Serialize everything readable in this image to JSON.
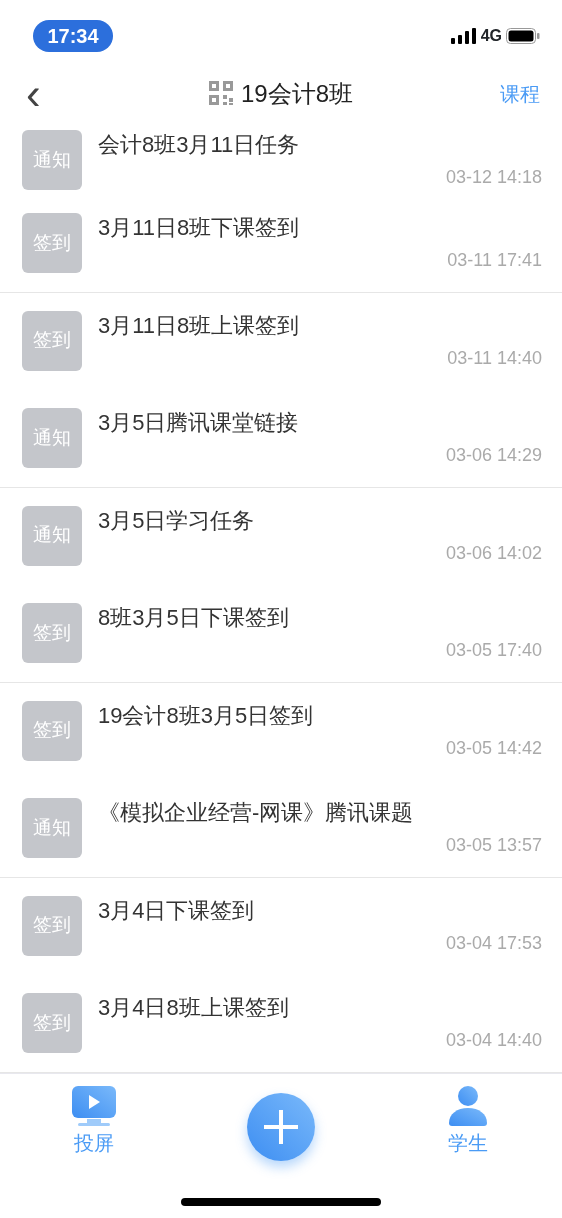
{
  "status_bar": {
    "time": "17:34",
    "network": "4G"
  },
  "nav": {
    "back": "‹",
    "title": "19会计8班",
    "action": "课程"
  },
  "items": [
    {
      "tag": "通知",
      "title": "会计8班3月11日任务",
      "time": "03-12 14:18"
    },
    {
      "tag": "签到",
      "title": "3月11日8班下课签到",
      "time": "03-11 17:41"
    },
    {
      "tag": "签到",
      "title": "3月11日8班上课签到",
      "time": "03-11 14:40"
    },
    {
      "tag": "通知",
      "title": "3月5日腾讯课堂链接",
      "time": "03-06 14:29"
    },
    {
      "tag": "通知",
      "title": "3月5日学习任务",
      "time": "03-06 14:02"
    },
    {
      "tag": "签到",
      "title": "8班3月5日下课签到",
      "time": "03-05 17:40"
    },
    {
      "tag": "签到",
      "title": "19会计8班3月5日签到",
      "time": "03-05 14:42"
    },
    {
      "tag": "通知",
      "title": "《模拟企业经营-网课》腾讯课题",
      "time": "03-05 13:57"
    },
    {
      "tag": "签到",
      "title": "3月4日下课签到",
      "time": "03-04 17:53"
    },
    {
      "tag": "签到",
      "title": "3月4日8班上课签到",
      "time": "03-04 14:40"
    }
  ],
  "tab_bar": [
    {
      "kind": "screen",
      "label": "投屏"
    },
    {
      "kind": "add"
    },
    {
      "kind": "student",
      "label": "学生"
    }
  ]
}
